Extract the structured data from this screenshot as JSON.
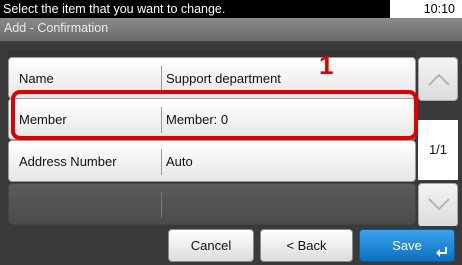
{
  "status": {
    "message": "Select the item that you want to change.",
    "time": "10:10"
  },
  "header": {
    "title": "Add - Confirmation"
  },
  "rows": [
    {
      "label": "Name",
      "value": "Support department"
    },
    {
      "label": "Member",
      "value": "Member: 0"
    },
    {
      "label": "Address Number",
      "value": "Auto"
    },
    {
      "label": "",
      "value": ""
    }
  ],
  "callout": "1",
  "pagination": "1/1",
  "buttons": {
    "cancel": "Cancel",
    "back": "< Back",
    "save": "Save"
  },
  "colors": {
    "highlight": "#e00000",
    "save_button": "#1a86d6"
  },
  "icons": {
    "scroll_up": "chevron-up-icon",
    "scroll_down": "chevron-down-icon",
    "enter": "enter-icon"
  }
}
